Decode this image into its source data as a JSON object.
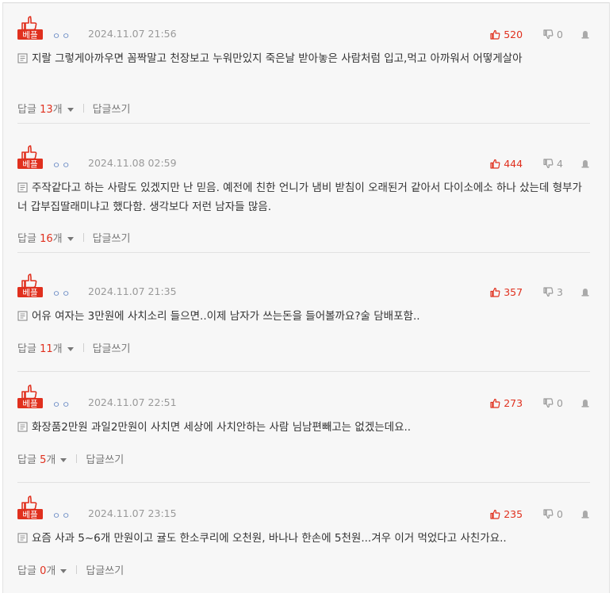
{
  "colors": {
    "accent": "#e0301e",
    "muted": "#999999",
    "author": "#6f8fc7"
  },
  "icons": {
    "badge": "thumbs-up-best-badge-icon",
    "like": "thumbs-up-icon",
    "dislike": "thumbs-down-icon",
    "report": "siren-report-icon",
    "memo": "memo-icon"
  },
  "comments": [
    {
      "badge": "베플",
      "author": "ㅇㅇ",
      "date": "2024.11.07 21:56",
      "likes": "520",
      "dislikes": "0",
      "text": "지랄 그렇게아까우면 꼼짝말고 천장보고 누워만있지 죽은날 받아놓은 사람처럼 입고,먹고 아까워서 어떻게살아",
      "reply_label": "답글",
      "reply_count": "13",
      "count_unit": "개",
      "write_reply": "답글쓰기"
    },
    {
      "badge": "베플",
      "author": "ㅇㅇ",
      "date": "2024.11.08 02:59",
      "likes": "444",
      "dislikes": "4",
      "text": "주작같다고 하는 사람도 있겠지만 난 믿음. 예전에 친한 언니가 냄비 받침이 오래된거 같아서 다이소에소 하나 샀는데 형부가 너 갑부집딸래미냐고 했다함. 생각보다 저런 남자들 많음.",
      "reply_label": "답글",
      "reply_count": "16",
      "count_unit": "개",
      "write_reply": "답글쓰기"
    },
    {
      "badge": "베플",
      "author": "ㅇㅇ",
      "date": "2024.11.07 21:35",
      "likes": "357",
      "dislikes": "3",
      "text": "어유 여자는 3만원에 사치소리 들으면..이제 남자가 쓰는돈을 들어볼까요?술 담배포함..",
      "reply_label": "답글",
      "reply_count": "11",
      "count_unit": "개",
      "write_reply": "답글쓰기"
    },
    {
      "badge": "베플",
      "author": "ㅇㅇ",
      "date": "2024.11.07 22:51",
      "likes": "273",
      "dislikes": "0",
      "text": "화장품2만원 과일2만원이 사치면 세상에 사치안하는 사람 님남편빼고는 없겠는데요..",
      "reply_label": "답글",
      "reply_count": "5",
      "count_unit": "개",
      "write_reply": "답글쓰기"
    },
    {
      "badge": "베플",
      "author": "ㅇㅇ",
      "date": "2024.11.07 23:15",
      "likes": "235",
      "dislikes": "0",
      "text": "요즘 사과 5~6개 만원이고 귤도 한소쿠리에 오천원, 바나나 한손에 5천원...겨우 이거 먹었다고 사친가요..",
      "reply_label": "답글",
      "reply_count": "0",
      "count_unit": "개",
      "write_reply": "답글쓰기"
    }
  ]
}
